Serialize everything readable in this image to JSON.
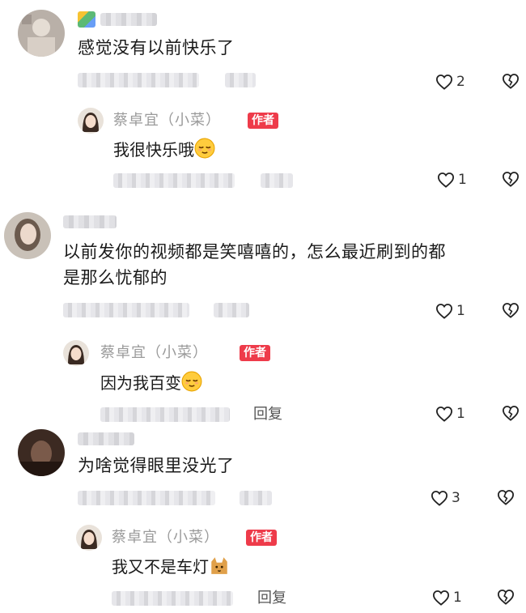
{
  "comments": [
    {
      "text": "感觉没有以前快乐了",
      "likes": "2",
      "reply": {
        "author": "蔡卓宜（小菜）",
        "badge": "作者",
        "text": "我很快乐哦",
        "likes": "1"
      }
    },
    {
      "text_line1": "以前发你的视频都是笑嘻嘻的，怎么最近刷到的都",
      "text_line2": "是那么忧郁的",
      "likes": "1",
      "reply": {
        "author": "蔡卓宜（小菜）",
        "badge": "作者",
        "text": "因为我百变",
        "reply_label": "回复",
        "likes": "1"
      }
    },
    {
      "text": "为啥觉得眼里没光了",
      "likes": "3",
      "reply": {
        "author": "蔡卓宜（小菜）",
        "badge": "作者",
        "text": "我又不是车灯",
        "reply_label": "回复",
        "likes": "1"
      }
    }
  ],
  "icons": {
    "like": "heart-outline-icon",
    "dislike": "broken-heart-icon",
    "emoji_relieved": "relieved-face-emoji",
    "emoji_cat": "cat-emoji"
  },
  "colors": {
    "badge": "#ee3b4a",
    "meta_text": "#9a9a9a"
  }
}
